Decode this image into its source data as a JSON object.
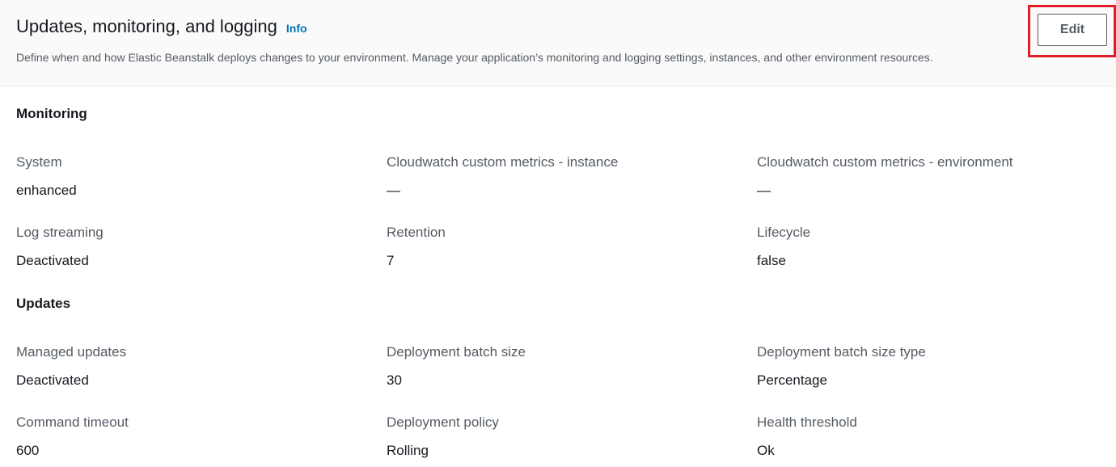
{
  "header": {
    "title": "Updates, monitoring, and logging",
    "info_label": "Info",
    "description": "Define when and how Elastic Beanstalk deploys changes to your environment. Manage your application’s monitoring and logging settings, instances, and other environment resources.",
    "edit_label": "Edit",
    "highlight_color": "#e11d2a"
  },
  "monitoring": {
    "title": "Monitoring",
    "fields": [
      {
        "label": "System",
        "value": "enhanced"
      },
      {
        "label": "Cloudwatch custom metrics - instance",
        "value": "—"
      },
      {
        "label": "Cloudwatch custom metrics - environment",
        "value": "—"
      },
      {
        "label": "Log streaming",
        "value": "Deactivated"
      },
      {
        "label": "Retention",
        "value": "7"
      },
      {
        "label": "Lifecycle",
        "value": "false"
      }
    ]
  },
  "updates": {
    "title": "Updates",
    "fields": [
      {
        "label": "Managed updates",
        "value": "Deactivated"
      },
      {
        "label": "Deployment batch size",
        "value": "30"
      },
      {
        "label": "Deployment batch size type",
        "value": "Percentage"
      },
      {
        "label": "Command timeout",
        "value": "600"
      },
      {
        "label": "Deployment policy",
        "value": "Rolling"
      },
      {
        "label": "Health threshold",
        "value": "Ok"
      }
    ]
  },
  "colors": {
    "link": "#0073bb",
    "text": "#16191f",
    "label": "#545b64",
    "header_bg": "#fafafa"
  }
}
